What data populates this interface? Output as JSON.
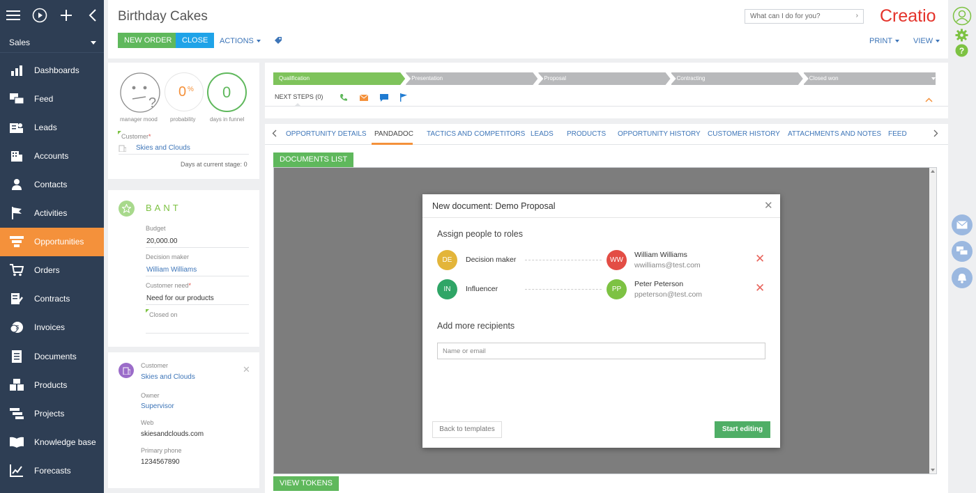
{
  "sidebar": {
    "workspace": "Sales",
    "items": [
      {
        "label": "Dashboards",
        "icon": "dashboards-icon"
      },
      {
        "label": "Feed",
        "icon": "feed-icon"
      },
      {
        "label": "Leads",
        "icon": "leads-icon"
      },
      {
        "label": "Accounts",
        "icon": "accounts-icon"
      },
      {
        "label": "Contacts",
        "icon": "contacts-icon"
      },
      {
        "label": "Activities",
        "icon": "activities-icon"
      },
      {
        "label": "Opportunities",
        "icon": "opportunities-icon",
        "active": true
      },
      {
        "label": "Orders",
        "icon": "orders-icon"
      },
      {
        "label": "Contracts",
        "icon": "contracts-icon"
      },
      {
        "label": "Invoices",
        "icon": "invoices-icon"
      },
      {
        "label": "Documents",
        "icon": "documents-icon"
      },
      {
        "label": "Products",
        "icon": "products-icon"
      },
      {
        "label": "Projects",
        "icon": "projects-icon"
      },
      {
        "label": "Knowledge base",
        "icon": "knowledge-base-icon"
      },
      {
        "label": "Forecasts",
        "icon": "forecasts-icon"
      }
    ]
  },
  "header": {
    "title": "Birthday Cakes",
    "new_order": "NEW ORDER",
    "close": "CLOSE",
    "actions": "ACTIONS",
    "search_placeholder": "What can I do for you?",
    "logo": "Creatio",
    "print": "PRINT",
    "view": "VIEW"
  },
  "kpi": {
    "mood_label": "manager mood",
    "probability_value": "0",
    "probability_unit": "%",
    "probability_label": "probability",
    "days_value": "0",
    "days_label": "days in funnel",
    "customer_label": "Customer",
    "customer_value": "Skies and Clouds",
    "days_stage_label": "Days at current stage:",
    "days_stage_value": "0"
  },
  "bant": {
    "title": "BANT",
    "budget_label": "Budget",
    "budget_value": "20,000.00",
    "decision_label": "Decision maker",
    "decision_value": "William Williams",
    "need_label": "Customer need",
    "need_value": "Need for our products",
    "closed_label": "Closed on"
  },
  "customer_card": {
    "customer_label": "Customer",
    "customer_value": "Skies and Clouds",
    "owner_label": "Owner",
    "owner_value": "Supervisor",
    "web_label": "Web",
    "web_value": "skiesandclouds.com",
    "phone_label": "Primary phone",
    "phone_value": "1234567890"
  },
  "stages": [
    "Qualification",
    "Presentation",
    "Proposal",
    "Contracting",
    "Closed won"
  ],
  "next_steps": "NEXT STEPS (0)",
  "tabs": [
    "OPPORTUNITY DETAILS",
    "PANDADOC",
    "TACTICS AND COMPETITORS",
    "LEADS",
    "PRODUCTS",
    "OPPORTUNITY HISTORY",
    "CUSTOMER HISTORY",
    "ATTACHMENTS AND NOTES",
    "FEED"
  ],
  "doc": {
    "documents_list": "DOCUMENTS LIST",
    "view_tokens": "VIEW TOKENS"
  },
  "modal": {
    "title": "New document: Demo Proposal",
    "assign_heading": "Assign people to roles",
    "roles": [
      {
        "initials": "DE",
        "role": "Decision maker",
        "role_color": "#e3b53a",
        "person_initials": "WW",
        "person_color": "#e34d45",
        "name": "William Williams",
        "email": "wwilliams@test.com"
      },
      {
        "initials": "IN",
        "role": "Influencer",
        "role_color": "#2fa566",
        "person_initials": "PP",
        "person_color": "#7dc243",
        "name": "Peter Peterson",
        "email": "ppeterson@test.com"
      }
    ],
    "add_heading": "Add more recipients",
    "input_placeholder": "Name or email",
    "back_button": "Back to templates",
    "start_button": "Start editing"
  }
}
